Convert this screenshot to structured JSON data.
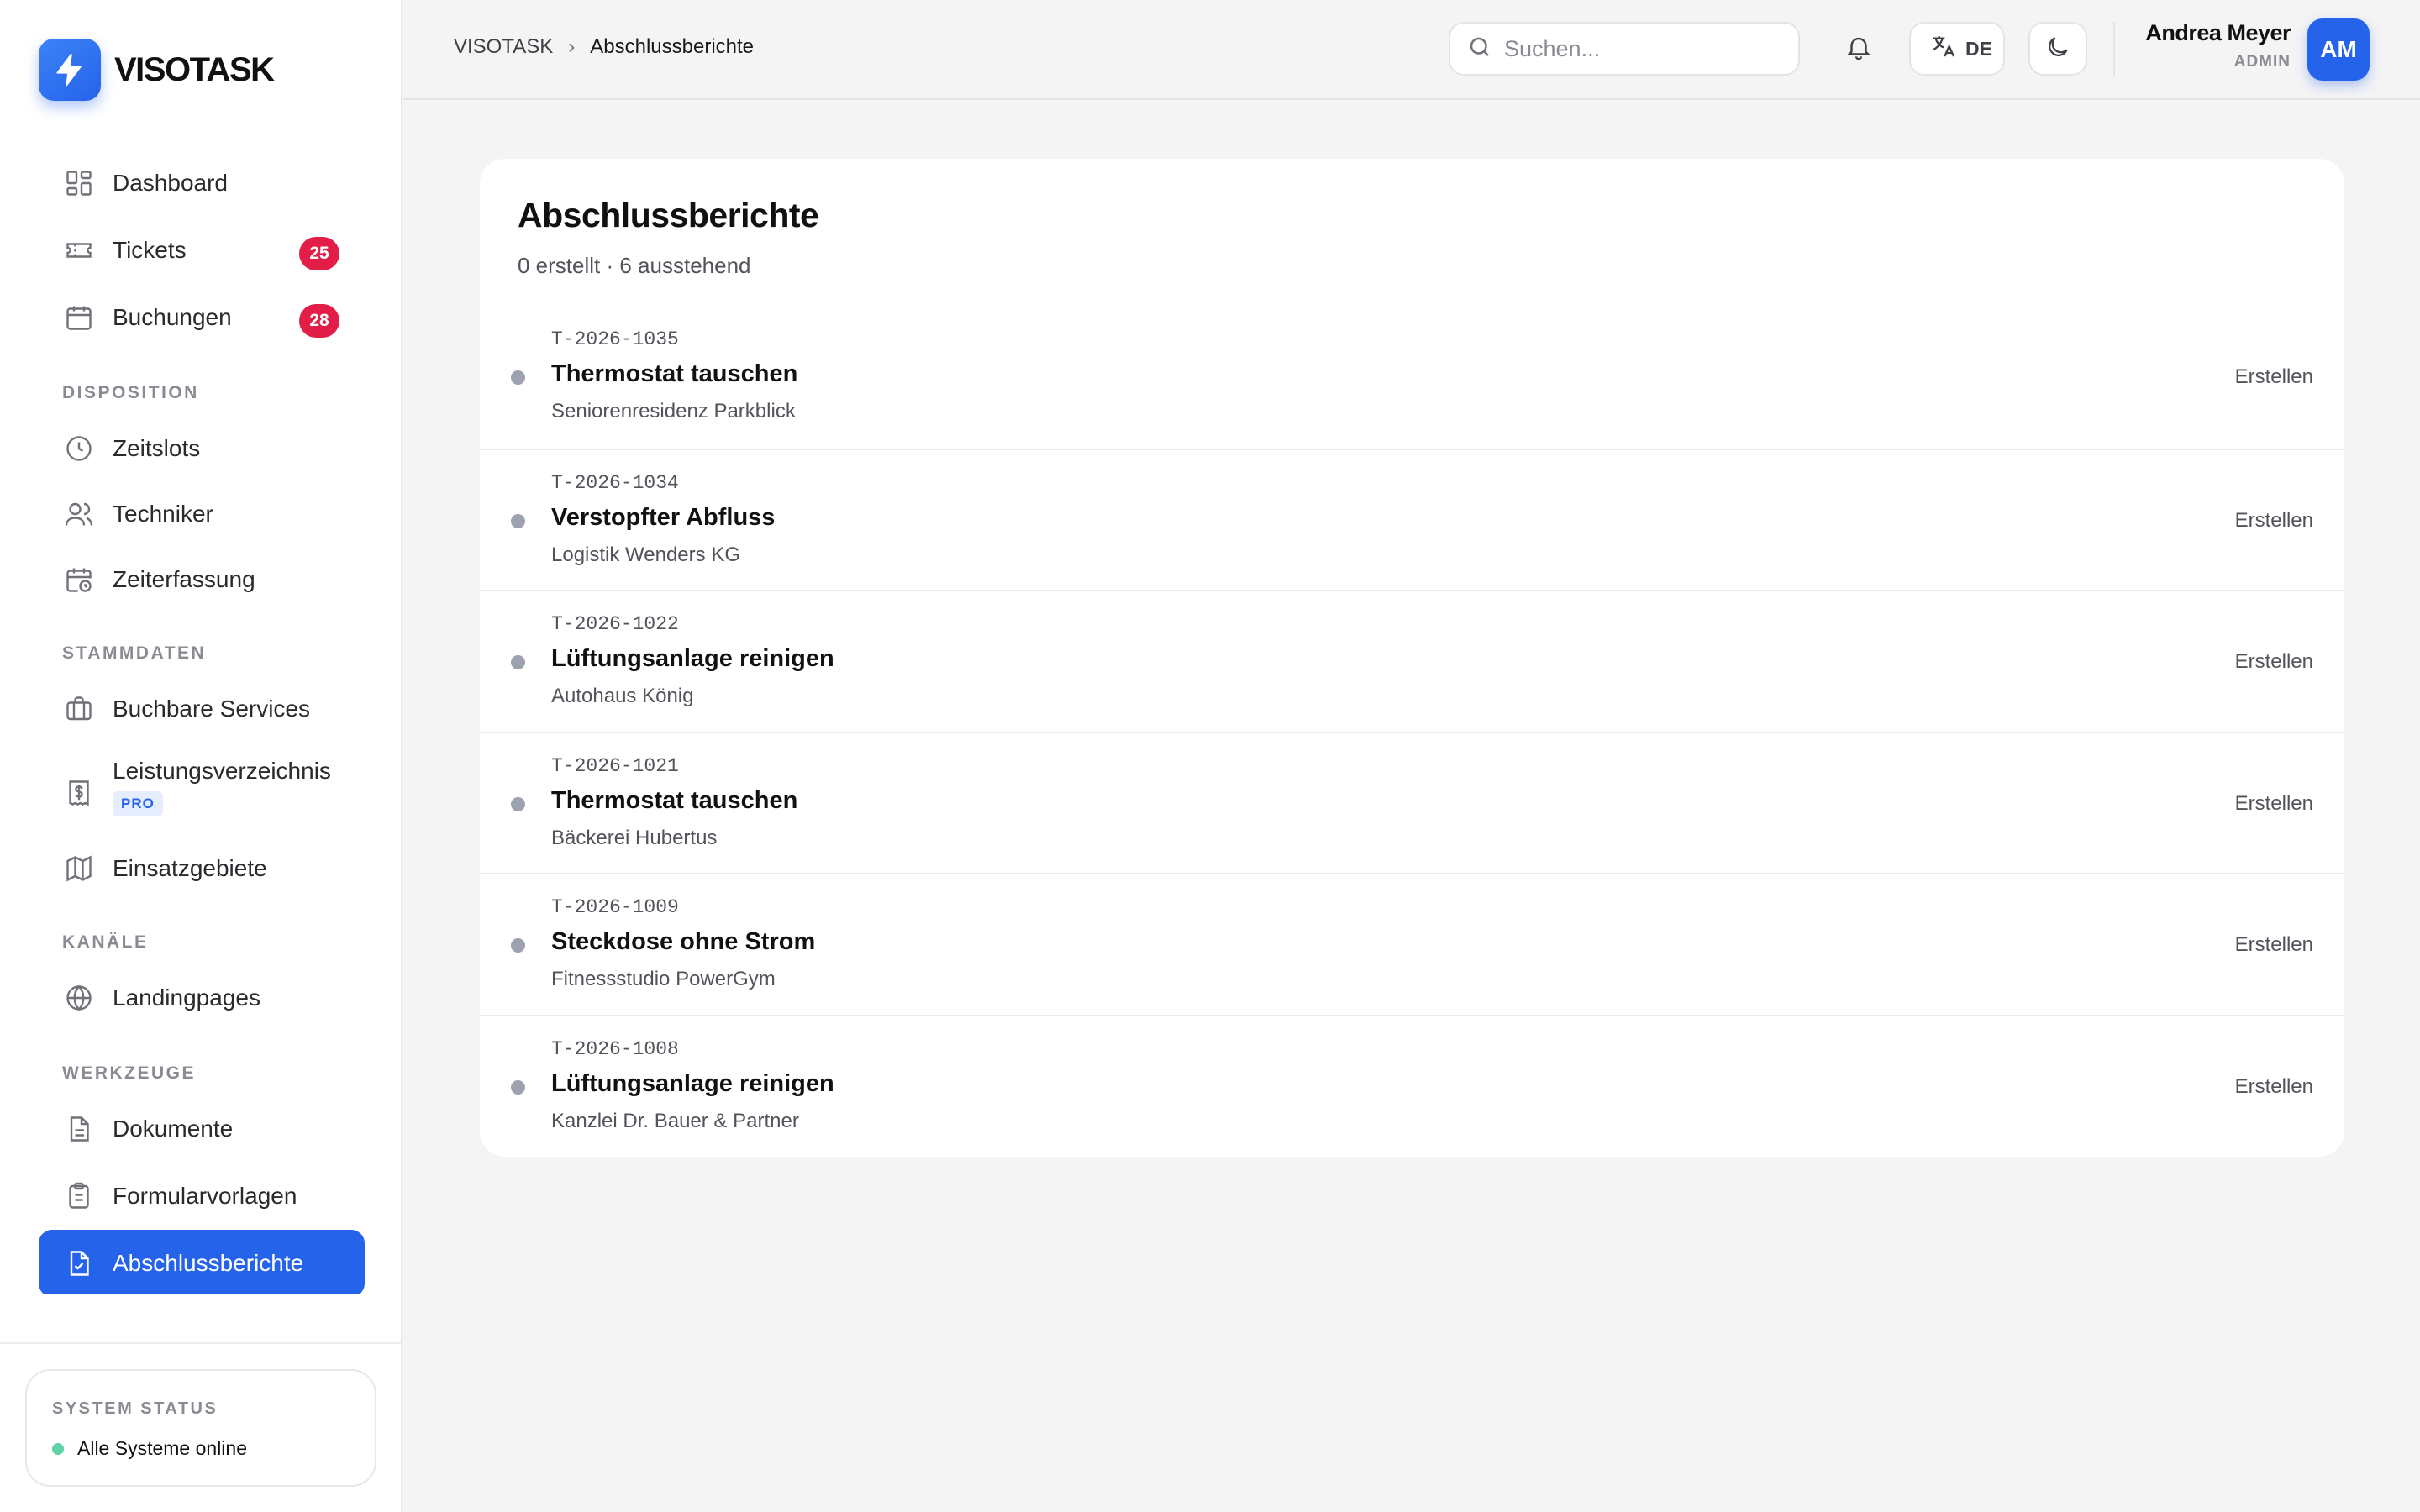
{
  "app": {
    "brand": "VISOTASK"
  },
  "sidebar": {
    "main_items": [
      {
        "label": "Dashboard",
        "icon": "dashboard-icon"
      },
      {
        "label": "Tickets",
        "icon": "ticket-icon",
        "badge": "25"
      },
      {
        "label": "Buchungen",
        "icon": "calendar-icon",
        "badge": "28"
      }
    ],
    "sections": [
      {
        "title": "DISPOSITION",
        "items": [
          {
            "label": "Zeitslots",
            "icon": "clock-icon"
          },
          {
            "label": "Techniker",
            "icon": "users-icon"
          },
          {
            "label": "Zeiterfassung",
            "icon": "calendar-clock-icon"
          }
        ]
      },
      {
        "title": "STAMMDATEN",
        "items": [
          {
            "label": "Buchbare Services",
            "icon": "briefcase-icon"
          },
          {
            "label": "Leistungsverzeichnis",
            "icon": "price-list-icon",
            "tag": "PRO"
          },
          {
            "label": "Einsatzgebiete",
            "icon": "map-icon"
          }
        ]
      },
      {
        "title": "KANÄLE",
        "items": [
          {
            "label": "Landingpages",
            "icon": "globe-icon"
          }
        ]
      },
      {
        "title": "WERKZEUGE",
        "items": [
          {
            "label": "Dokumente",
            "icon": "document-icon"
          },
          {
            "label": "Formularvorlagen",
            "icon": "clipboard-icon"
          },
          {
            "label": "Abschlussberichte",
            "icon": "report-icon",
            "active": true
          }
        ]
      }
    ],
    "system_status": {
      "label": "SYSTEM STATUS",
      "text": "Alle Systeme online",
      "color": "#5fd3a7"
    }
  },
  "header": {
    "breadcrumb": [
      "VISOTASK",
      "Abschlussberichte"
    ],
    "search_placeholder": "Suchen...",
    "language": "DE",
    "user": {
      "name": "Andrea Meyer",
      "role": "ADMIN",
      "initials": "AM"
    }
  },
  "main": {
    "title": "Abschlussberichte",
    "subtitle": "0 erstellt · 6 ausstehend",
    "reports": [
      {
        "id": "T-2026-1035",
        "title": "Thermostat tauschen",
        "company": "Seniorenresidenz Parkblick",
        "action": "Erstellen"
      },
      {
        "id": "T-2026-1034",
        "title": "Verstopfter Abfluss",
        "company": "Logistik Wenders KG",
        "action": "Erstellen"
      },
      {
        "id": "T-2026-1022",
        "title": "Lüftungsanlage reinigen",
        "company": "Autohaus König",
        "action": "Erstellen"
      },
      {
        "id": "T-2026-1021",
        "title": "Thermostat tauschen",
        "company": "Bäckerei Hubertus",
        "action": "Erstellen"
      },
      {
        "id": "T-2026-1009",
        "title": "Steckdose ohne Strom",
        "company": "Fitnessstudio PowerGym",
        "action": "Erstellen"
      },
      {
        "id": "T-2026-1008",
        "title": "Lüftungsanlage reinigen",
        "company": "Kanzlei Dr. Bauer & Partner",
        "action": "Erstellen"
      }
    ]
  },
  "colors": {
    "accent": "#2563eb",
    "badge": "#e11d48",
    "status_online": "#5fd3a7"
  }
}
